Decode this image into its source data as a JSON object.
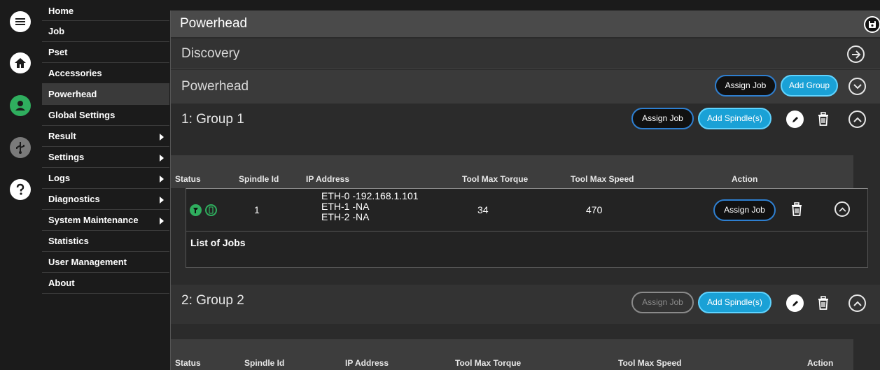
{
  "nav": {
    "items": [
      {
        "label": "Home"
      },
      {
        "label": "Job"
      },
      {
        "label": "Pset"
      },
      {
        "label": "Accessories"
      },
      {
        "label": "Powerhead"
      },
      {
        "label": "Global Settings"
      },
      {
        "label": "Result"
      },
      {
        "label": "Settings"
      },
      {
        "label": "Logs"
      },
      {
        "label": "Diagnostics"
      },
      {
        "label": "System Maintenance"
      },
      {
        "label": "Statistics"
      },
      {
        "label": "User Management"
      },
      {
        "label": "About"
      }
    ]
  },
  "header": {
    "title": "Powerhead"
  },
  "discovery": {
    "title": "Discovery"
  },
  "powerhead_section": {
    "title": "Powerhead",
    "assign_job": "Assign Job",
    "add_group": "Add Group"
  },
  "group1": {
    "title": "1: Group 1",
    "assign_job": "Assign Job",
    "add_spindle": "Add Spindle(s)",
    "columns": {
      "status": "Status",
      "spindle_id": "Spindle Id",
      "ip": "IP Address",
      "torque": "Tool Max Torque",
      "speed": "Tool Max Speed",
      "action": "Action"
    },
    "rows": [
      {
        "spindle_id": "1",
        "ip_0": "ETH-0 -192.168.1.101",
        "ip_1": "ETH-1 -NA",
        "ip_2": "ETH-2 -NA",
        "torque": "34",
        "speed": "470",
        "assign_job": "Assign Job"
      }
    ],
    "jobs_label": "List of Jobs"
  },
  "group2": {
    "title": "2: Group 2",
    "assign_job": "Assign Job",
    "add_spindle": "Add Spindle(s)",
    "columns": {
      "status": "Status",
      "spindle_id": "Spindle Id",
      "ip": "IP Address",
      "torque": "Tool Max Torque",
      "speed": "Tool Max Speed",
      "action": "Action"
    }
  },
  "colors": {
    "accent": "#1aa1d6",
    "outline": "#2e7fd0",
    "status_green": "#2fae5e"
  }
}
